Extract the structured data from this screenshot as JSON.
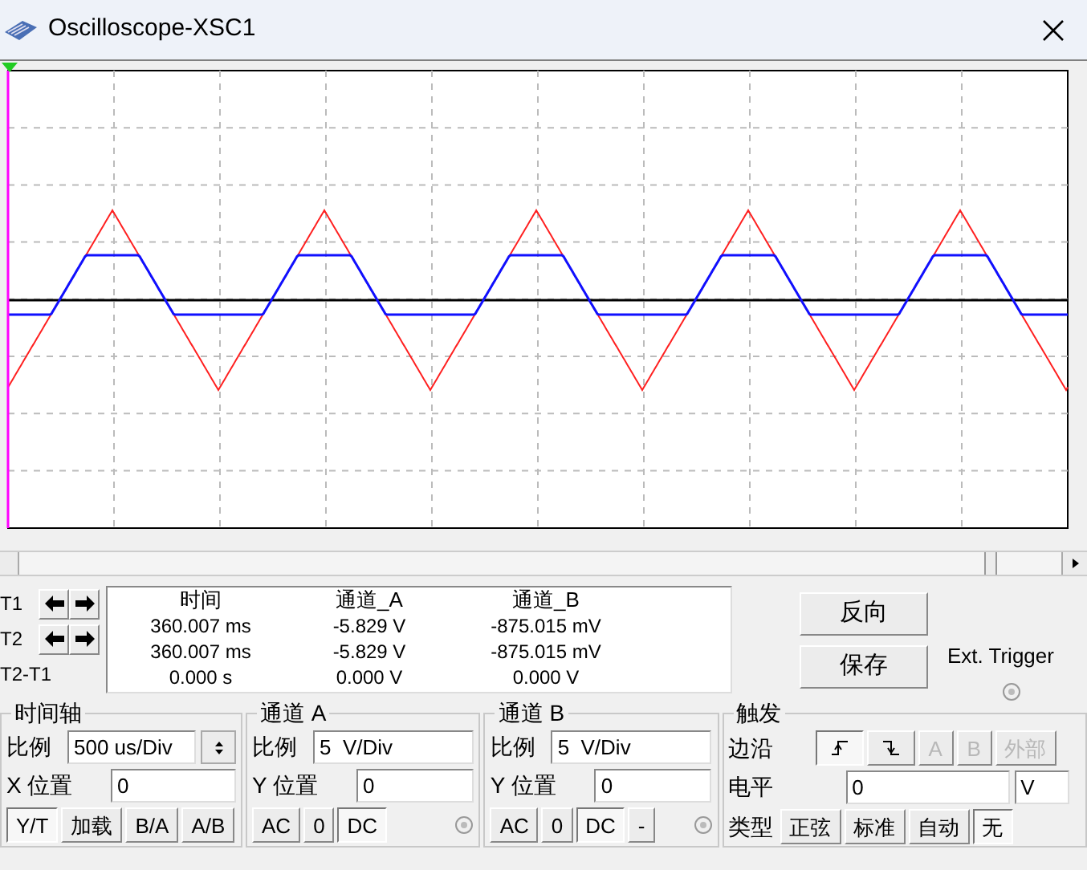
{
  "window": {
    "title": "Oscilloscope-XSC1"
  },
  "cursors": [
    {
      "label": "T1"
    },
    {
      "label": "T2"
    },
    {
      "label": "T2-T1"
    }
  ],
  "readings": {
    "columns": [
      "时间",
      "通道_A",
      "通道_B"
    ],
    "rows": [
      {
        "cells": [
          "360.007 ms",
          "-5.829 V",
          "-875.015 mV"
        ]
      },
      {
        "cells": [
          "360.007 ms",
          "-5.829 V",
          "-875.015 mV"
        ]
      },
      {
        "cells": [
          "0.000 s",
          "0.000 V",
          "0.000 V"
        ]
      }
    ]
  },
  "buttons": [
    "反向",
    "保存"
  ],
  "ext_trigger": "Ext. Trigger",
  "timebase": {
    "title": "时间轴",
    "scale_label": "比例",
    "scale_value": "500 us/Div",
    "pos_label": "X 位置",
    "pos_value": "0",
    "modes": [
      {
        "label": "Y/T",
        "selected": true
      },
      {
        "label": "加载",
        "selected": false
      },
      {
        "label": "B/A",
        "selected": false
      },
      {
        "label": "A/B",
        "selected": false
      }
    ]
  },
  "channels": [
    {
      "title": "通道 A",
      "scale_label": "比例",
      "scale_value": "5  V/Div",
      "pos_label": "Y 位置",
      "pos_value": "0",
      "coupling": [
        {
          "label": "AC",
          "selected": false
        },
        {
          "label": "0",
          "selected": false
        },
        {
          "label": "DC",
          "selected": true
        }
      ]
    },
    {
      "title": "通道 B",
      "scale_label": "比例",
      "scale_value": "5  V/Div",
      "pos_label": "Y 位置",
      "pos_value": "0",
      "coupling": [
        {
          "label": "AC",
          "selected": false
        },
        {
          "label": "0",
          "selected": false
        },
        {
          "label": "DC",
          "selected": true
        },
        {
          "label": "-",
          "selected": false
        }
      ]
    }
  ],
  "trigger": {
    "title": "触发",
    "edge_label": "边沿",
    "edges": [
      {
        "kind": "rising",
        "selected": true
      },
      {
        "kind": "falling",
        "selected": false
      }
    ],
    "sources": [
      {
        "label": "A",
        "disabled": true
      },
      {
        "label": "B",
        "disabled": true
      },
      {
        "label": "外部",
        "disabled": true
      }
    ],
    "level_label": "电平",
    "level_value": "0",
    "level_unit": "V",
    "type_label": "类型",
    "types": [
      {
        "label": "正弦",
        "selected": false
      },
      {
        "label": "标准",
        "selected": false
      },
      {
        "label": "自动",
        "selected": false
      },
      {
        "label": "无",
        "selected": true
      }
    ]
  }
}
